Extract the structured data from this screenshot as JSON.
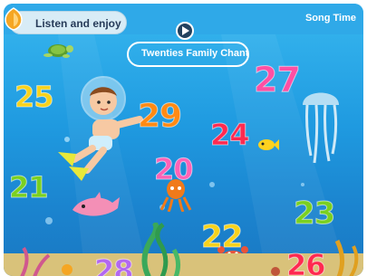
{
  "header": {
    "listen_label": "Listen and enjoy",
    "song_time_label": "Song Time"
  },
  "song": {
    "title": "Twenties Family Chant"
  },
  "numbers": [
    {
      "label": "25",
      "color": "#f7d21c"
    },
    {
      "label": "29",
      "color": "#ff8a14"
    },
    {
      "label": "27",
      "color": "#ff4fa3"
    },
    {
      "label": "24",
      "color": "#ff2a50"
    },
    {
      "label": "21",
      "color": "#7ad021"
    },
    {
      "label": "20",
      "color": "#ff62b6"
    },
    {
      "label": "22",
      "color": "#f7d21c"
    },
    {
      "label": "23",
      "color": "#7ad021"
    },
    {
      "label": "26",
      "color": "#ff2a50"
    },
    {
      "label": "28",
      "color": "#b267f0"
    }
  ],
  "icons": {
    "logo": "orange-shield-icon",
    "play": "play-icon"
  }
}
